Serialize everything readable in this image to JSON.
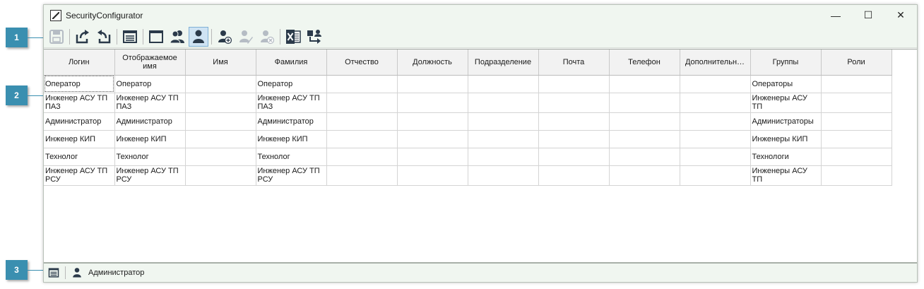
{
  "window": {
    "title": "SecurityConfigurator",
    "minimize_glyph": "—",
    "maximize_glyph": "☐",
    "close_glyph": "✕"
  },
  "callouts": [
    "1",
    "2",
    "3"
  ],
  "toolbar": {
    "buttons": [
      {
        "icon": "save-icon",
        "enabled": false
      },
      {
        "icon": "export-icon",
        "enabled": true
      },
      {
        "icon": "import-icon",
        "enabled": true
      },
      {
        "icon": "list-view-icon",
        "enabled": true
      },
      {
        "icon": "window-icon",
        "enabled": true
      },
      {
        "icon": "groups-icon",
        "enabled": true
      },
      {
        "icon": "user-icon",
        "enabled": true,
        "active": true
      },
      {
        "icon": "add-user-icon",
        "enabled": true
      },
      {
        "icon": "edit-user-icon",
        "enabled": false
      },
      {
        "icon": "delete-user-icon",
        "enabled": false
      },
      {
        "icon": "excel-icon",
        "enabled": true
      },
      {
        "icon": "transfer-users-icon",
        "enabled": true
      }
    ]
  },
  "table": {
    "columns": [
      "Логин",
      "Отображаемое имя",
      "Имя",
      "Фамилия",
      "Отчество",
      "Должность",
      "Подразделение",
      "Почта",
      "Телефон",
      "Дополнительн…",
      "Группы",
      "Роли"
    ],
    "rows": [
      [
        "Оператор",
        "Оператор",
        "",
        "Оператор",
        "",
        "",
        "",
        "",
        "",
        "",
        "Операторы",
        ""
      ],
      [
        "Инженер АСУ ТП ПАЗ",
        "Инженер АСУ ТП ПАЗ",
        "",
        "Инженер АСУ ТП ПАЗ",
        "",
        "",
        "",
        "",
        "",
        "",
        "Инженеры АСУ ТП",
        ""
      ],
      [
        "Администратор",
        "Администратор",
        "",
        "Администратор",
        "",
        "",
        "",
        "",
        "",
        "",
        "Администраторы",
        ""
      ],
      [
        "Инженер КИП",
        "Инженер КИП",
        "",
        "Инженер КИП",
        "",
        "",
        "",
        "",
        "",
        "",
        "Инженеры КИП",
        ""
      ],
      [
        "Технолог",
        "Технолог",
        "",
        "Технолог",
        "",
        "",
        "",
        "",
        "",
        "",
        "Технологи",
        ""
      ],
      [
        "Инженер АСУ ТП РСУ",
        "Инженер АСУ ТП РСУ",
        "",
        "Инженер АСУ ТП РСУ",
        "",
        "",
        "",
        "",
        "",
        "",
        "Инженеры АСУ ТП",
        ""
      ]
    ]
  },
  "statusbar": {
    "current_user": "Администратор"
  },
  "colors": {
    "accent_callout": "#3a8fb0",
    "chrome_bg": "#f0f6f0",
    "icon_color": "#2b3a4a"
  }
}
